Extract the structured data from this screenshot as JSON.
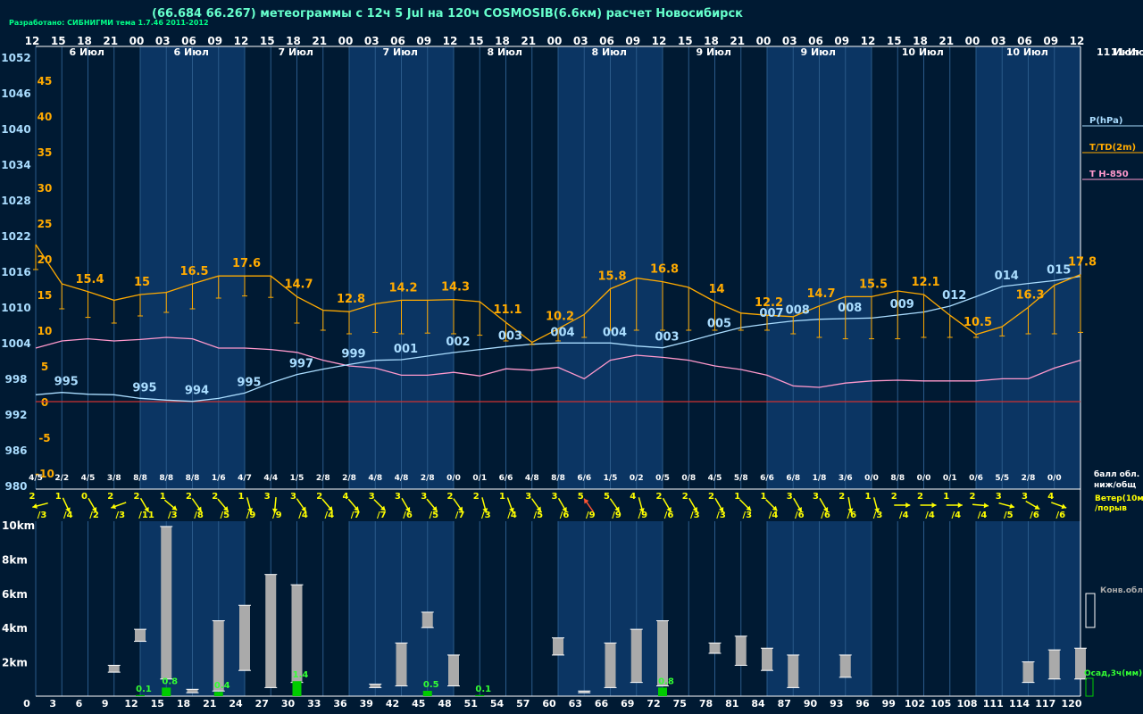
{
  "header": {
    "title": "(66.684 66.267) метеограммы с  12ч 5 Jul на 120ч COSMOSIB(6.6км) расчет Новосибирск",
    "developer": "Разработано: СИБНИГМИ тема 1.7.46 2011-2012"
  },
  "colors": {
    "pressure": "#aaddff",
    "temperature": "#ffaa00",
    "t850": "#ff99cc",
    "zero_line": "#cc3333",
    "wind": "#ffff00",
    "cloud": "#aaaaaa",
    "precip": "#00cc00"
  },
  "chart_data": {
    "type": "line",
    "hours": [
      "12",
      "15",
      "18",
      "21",
      "00",
      "03",
      "06",
      "09",
      "12",
      "15",
      "18",
      "21",
      "00",
      "03",
      "06",
      "09",
      "12",
      "15",
      "18",
      "21",
      "00",
      "03",
      "06",
      "09",
      "12",
      "15",
      "18",
      "21",
      "00",
      "03",
      "06",
      "09",
      "12",
      "15",
      "18",
      "21",
      "00",
      "03",
      "06",
      "09",
      "12"
    ],
    "day_labels": [
      "6 Июл",
      "6 Июл",
      "7 Июл",
      "7 Июл",
      "8 Июл",
      "8 Июл",
      "9 Июл",
      "9 Июл",
      "10 Июл",
      "10 Июл",
      "11 Июл"
    ],
    "lead_hours": [
      "0",
      "3",
      "6",
      "9",
      "12",
      "15",
      "18",
      "21",
      "24",
      "27",
      "30",
      "33",
      "36",
      "39",
      "42",
      "45",
      "48",
      "51",
      "54",
      "57",
      "60",
      "63",
      "66",
      "69",
      "72",
      "75",
      "78",
      "81",
      "84",
      "87",
      "90",
      "93",
      "96",
      "99",
      "102",
      "105",
      "108",
      "111",
      "114",
      "117",
      "120"
    ],
    "pressure_ticks": [
      "1052",
      "1046",
      "1040",
      "1034",
      "1028",
      "1022",
      "1016",
      "1010",
      "1004",
      "998",
      "992",
      "986",
      "980"
    ],
    "temp_ticks": [
      "45",
      "40",
      "35",
      "30",
      "25",
      "20",
      "15",
      "10",
      "5",
      "0",
      "-5",
      "-10"
    ],
    "ylim_pressure": [
      980,
      1052
    ],
    "ylim_temp": [
      -10,
      45
    ],
    "legend": {
      "pressure": "P(hPa)",
      "temperature": "T/TD(2m)",
      "t850": "T H-850",
      "clouds": "балл обл.",
      "clouds2": "ниж/общ",
      "wind": "Ветер(10м)",
      "gust": "/порыв",
      "conv": "Конв.обл.",
      "precip": "Осад,3ч(мм)"
    },
    "pressure": [
      995.4,
      995.8,
      995.5,
      995.4,
      994.8,
      994.5,
      994.3,
      994.8,
      995.7,
      997.4,
      998.8,
      999.7,
      1000.5,
      1001.2,
      1001.3,
      1001.9,
      1002.5,
      1003.0,
      1003.5,
      1003.9,
      1004.1,
      1004.1,
      1004.1,
      1003.6,
      1003.3,
      1004.4,
      1005.6,
      1006.7,
      1007.3,
      1007.8,
      1008.1,
      1008.2,
      1008.3,
      1008.8,
      1009.3,
      1010.3,
      1011.9,
      1013.6,
      1014.1,
      1014.6,
      1015.3
    ],
    "pressure_labels": [
      {
        "i": 1,
        "t": "995"
      },
      {
        "i": 4,
        "t": "995"
      },
      {
        "i": 6,
        "t": "994"
      },
      {
        "i": 8,
        "t": "995"
      },
      {
        "i": 10,
        "t": "997"
      },
      {
        "i": 12,
        "t": "999"
      },
      {
        "i": 14,
        "t": "001"
      },
      {
        "i": 16,
        "t": "002"
      },
      {
        "i": 18,
        "t": "003"
      },
      {
        "i": 20,
        "t": "004"
      },
      {
        "i": 22,
        "t": "004"
      },
      {
        "i": 24,
        "t": "003"
      },
      {
        "i": 26,
        "t": "005"
      },
      {
        "i": 28,
        "t": "007"
      },
      {
        "i": 29,
        "t": "008"
      },
      {
        "i": 31,
        "t": "008"
      },
      {
        "i": 33,
        "t": "009"
      },
      {
        "i": 35,
        "t": "012"
      },
      {
        "i": 37,
        "t": "014"
      },
      {
        "i": 39,
        "t": "015"
      }
    ],
    "temperature": [
      22.0,
      16.5,
      15.4,
      14.2,
      15.0,
      15.3,
      16.5,
      17.6,
      17.6,
      17.6,
      14.7,
      12.8,
      12.6,
      13.7,
      14.2,
      14.2,
      14.3,
      14.0,
      11.1,
      8.3,
      10.2,
      12.2,
      15.8,
      17.3,
      16.8,
      16.0,
      14.0,
      12.4,
      12.1,
      11.9,
      13.4,
      14.7,
      14.7,
      15.5,
      15.0,
      12.1,
      9.4,
      10.5,
      13.2,
      16.3,
      17.8
    ],
    "temperature_labels": [
      {
        "i": 2,
        "t": "15.4"
      },
      {
        "i": 4,
        "t": "15"
      },
      {
        "i": 6,
        "t": "16.5"
      },
      {
        "i": 8,
        "t": "17.6"
      },
      {
        "i": 10,
        "t": "14.7"
      },
      {
        "i": 12,
        "t": "12.8"
      },
      {
        "i": 14,
        "t": "14.2"
      },
      {
        "i": 16,
        "t": "14.3"
      },
      {
        "i": 18,
        "t": "11.1"
      },
      {
        "i": 20,
        "t": "10.2"
      },
      {
        "i": 22,
        "t": "15.8"
      },
      {
        "i": 24,
        "t": "16.8"
      },
      {
        "i": 26,
        "t": "14"
      },
      {
        "i": 28,
        "t": "12.2"
      },
      {
        "i": 30,
        "t": "14.7"
      },
      {
        "i": 32,
        "t": "15.5"
      },
      {
        "i": 34,
        "t": "12.1"
      },
      {
        "i": 36,
        "t": "10.5"
      },
      {
        "i": 38,
        "t": "16.3"
      },
      {
        "i": 40,
        "t": "17.8"
      }
    ],
    "dewpoint": [
      18.5,
      13.0,
      11.8,
      11.0,
      12.0,
      12.5,
      13.0,
      14.5,
      14.8,
      14.6,
      11.0,
      10.0,
      9.5,
      9.7,
      9.5,
      9.6,
      9.5,
      9.3,
      8.5,
      8.0,
      8.5,
      9.0,
      10.0,
      10.0,
      10.0,
      10.0,
      10.0,
      10.0,
      10.0,
      9.5,
      9.0,
      8.8,
      8.8,
      8.8,
      9.0,
      9.0,
      9.0,
      9.2,
      9.5,
      9.5,
      9.7
    ],
    "t850": [
      7.5,
      8.5,
      8.8,
      8.5,
      8.7,
      9.0,
      8.8,
      7.5,
      7.5,
      7.3,
      6.9,
      5.8,
      5.0,
      4.7,
      3.7,
      3.7,
      4.1,
      3.6,
      4.6,
      4.4,
      4.8,
      3.2,
      5.8,
      6.5,
      6.2,
      5.8,
      5.0,
      4.5,
      3.7,
      2.2,
      2.0,
      2.6,
      2.9,
      3.0,
      2.9,
      2.9,
      2.9,
      3.2,
      3.2,
      4.7,
      5.8
    ],
    "clouds": [
      "4/5",
      "2/2",
      "4/5",
      "3/8",
      "8/8",
      "8/8",
      "8/8",
      "1/6",
      "4/7",
      "4/4",
      "1/5",
      "2/8",
      "2/8",
      "4/8",
      "4/8",
      "2/8",
      "0/0",
      "0/1",
      "6/6",
      "4/8",
      "8/8",
      "6/6",
      "1/5",
      "0/2",
      "0/5",
      "0/8",
      "4/5",
      "5/8",
      "6/6",
      "6/8",
      "1/8",
      "3/6",
      "0/0",
      "8/8",
      "0/0",
      "0/1",
      "0/6",
      "5/5",
      "2/8",
      "0/0"
    ],
    "wind": [
      {
        "s": "2",
        "g": "/3",
        "d": 165
      },
      {
        "s": "1",
        "g": "/4",
        "d": 65
      },
      {
        "s": "0",
        "g": "/2",
        "d": 60
      },
      {
        "s": "2",
        "g": "/3",
        "d": 160
      },
      {
        "s": "2",
        "g": "/11",
        "d": 60
      },
      {
        "s": "1",
        "g": "/3",
        "d": 40
      },
      {
        "s": "2",
        "g": "/8",
        "d": 55
      },
      {
        "s": "2",
        "g": "/5",
        "d": 50
      },
      {
        "s": "1",
        "g": "/9",
        "d": 75
      },
      {
        "s": "3",
        "g": "/9",
        "d": 95
      },
      {
        "s": "3",
        "g": "/4",
        "d": 55
      },
      {
        "s": "2",
        "g": "/4",
        "d": 50
      },
      {
        "s": "4",
        "g": "/7",
        "d": 50
      },
      {
        "s": "3",
        "g": "/7",
        "d": 45
      },
      {
        "s": "3",
        "g": "/6",
        "d": 60
      },
      {
        "s": "3",
        "g": "/5",
        "d": 50
      },
      {
        "s": "2",
        "g": "/7",
        "d": 55
      },
      {
        "s": "2",
        "g": "/3",
        "d": 75
      },
      {
        "s": "1",
        "g": "/4",
        "d": 70
      },
      {
        "s": "3",
        "g": "/5",
        "d": 55
      },
      {
        "s": "3",
        "g": "/6",
        "d": 60
      },
      {
        "s": "5",
        "g": "/9",
        "d": 235
      },
      {
        "s": "5",
        "g": "/9",
        "d": 55
      },
      {
        "s": "4",
        "g": "/9",
        "d": 75
      },
      {
        "s": "2",
        "g": "/6",
        "d": 60
      },
      {
        "s": "2",
        "g": "/3",
        "d": 60
      },
      {
        "s": "2",
        "g": "/3",
        "d": 60
      },
      {
        "s": "1",
        "g": "/3",
        "d": 45
      },
      {
        "s": "1",
        "g": "/4",
        "d": 45
      },
      {
        "s": "3",
        "g": "/6",
        "d": 60
      },
      {
        "s": "3",
        "g": "/6",
        "d": 60
      },
      {
        "s": "2",
        "g": "/6",
        "d": 80
      },
      {
        "s": "1",
        "g": "/3",
        "d": 75
      },
      {
        "s": "2",
        "g": "/4",
        "d": 0
      },
      {
        "s": "2",
        "g": "/4",
        "d": 0
      },
      {
        "s": "1",
        "g": "/4",
        "d": 0
      },
      {
        "s": "2",
        "g": "/4",
        "d": 5
      },
      {
        "s": "3",
        "g": "/5",
        "d": 15
      },
      {
        "s": "3",
        "g": "/6",
        "d": 30
      },
      {
        "s": "4",
        "g": "/6",
        "d": 20
      }
    ],
    "conv_clouds": [
      {
        "i": 3,
        "lo": 1.4,
        "hi": 1.8
      },
      {
        "i": 4,
        "lo": 3.2,
        "hi": 3.9
      },
      {
        "i": 5,
        "lo": 1.0,
        "hi": 9.9
      },
      {
        "i": 6,
        "lo": 0.2,
        "hi": 0.4
      },
      {
        "i": 7,
        "lo": 0.3,
        "hi": 4.4
      },
      {
        "i": 8,
        "lo": 1.5,
        "hi": 5.3
      },
      {
        "i": 9,
        "lo": 0.5,
        "hi": 7.1
      },
      {
        "i": 10,
        "lo": 0.8,
        "hi": 6.5
      },
      {
        "i": 13,
        "lo": 0.5,
        "hi": 0.7
      },
      {
        "i": 14,
        "lo": 0.6,
        "hi": 3.1
      },
      {
        "i": 15,
        "lo": 4.0,
        "hi": 4.9
      },
      {
        "i": 16,
        "lo": 0.6,
        "hi": 2.4
      },
      {
        "i": 20,
        "lo": 2.4,
        "hi": 3.4
      },
      {
        "i": 21,
        "lo": 0.2,
        "hi": 0.3
      },
      {
        "i": 22,
        "lo": 0.5,
        "hi": 3.1
      },
      {
        "i": 23,
        "lo": 0.8,
        "hi": 3.9
      },
      {
        "i": 24,
        "lo": 0.6,
        "hi": 4.4
      },
      {
        "i": 26,
        "lo": 2.5,
        "hi": 3.1
      },
      {
        "i": 27,
        "lo": 1.8,
        "hi": 3.5
      },
      {
        "i": 28,
        "lo": 1.5,
        "hi": 2.8
      },
      {
        "i": 29,
        "lo": 0.5,
        "hi": 2.4
      },
      {
        "i": 31,
        "lo": 1.1,
        "hi": 2.4
      },
      {
        "i": 38,
        "lo": 0.8,
        "hi": 2.0
      },
      {
        "i": 39,
        "lo": 1.0,
        "hi": 2.7
      },
      {
        "i": 40,
        "lo": 1.0,
        "hi": 2.8
      }
    ],
    "precip": [
      {
        "i": 5,
        "v": 0.8,
        "t": "0.8"
      },
      {
        "i": 4,
        "v": 0.1,
        "t": "0.1"
      },
      {
        "i": 7,
        "v": 0.4,
        "t": "0.4"
      },
      {
        "i": 10,
        "v": 1.4,
        "t": "1.4"
      },
      {
        "i": 15,
        "v": 0.5,
        "t": "0.5"
      },
      {
        "i": 17,
        "v": 0.1,
        "t": "0.1"
      },
      {
        "i": 24,
        "v": 0.8,
        "t": "0.8"
      }
    ],
    "height_ticks": [
      "10km",
      "8km",
      "6km",
      "4km",
      "2km"
    ]
  }
}
